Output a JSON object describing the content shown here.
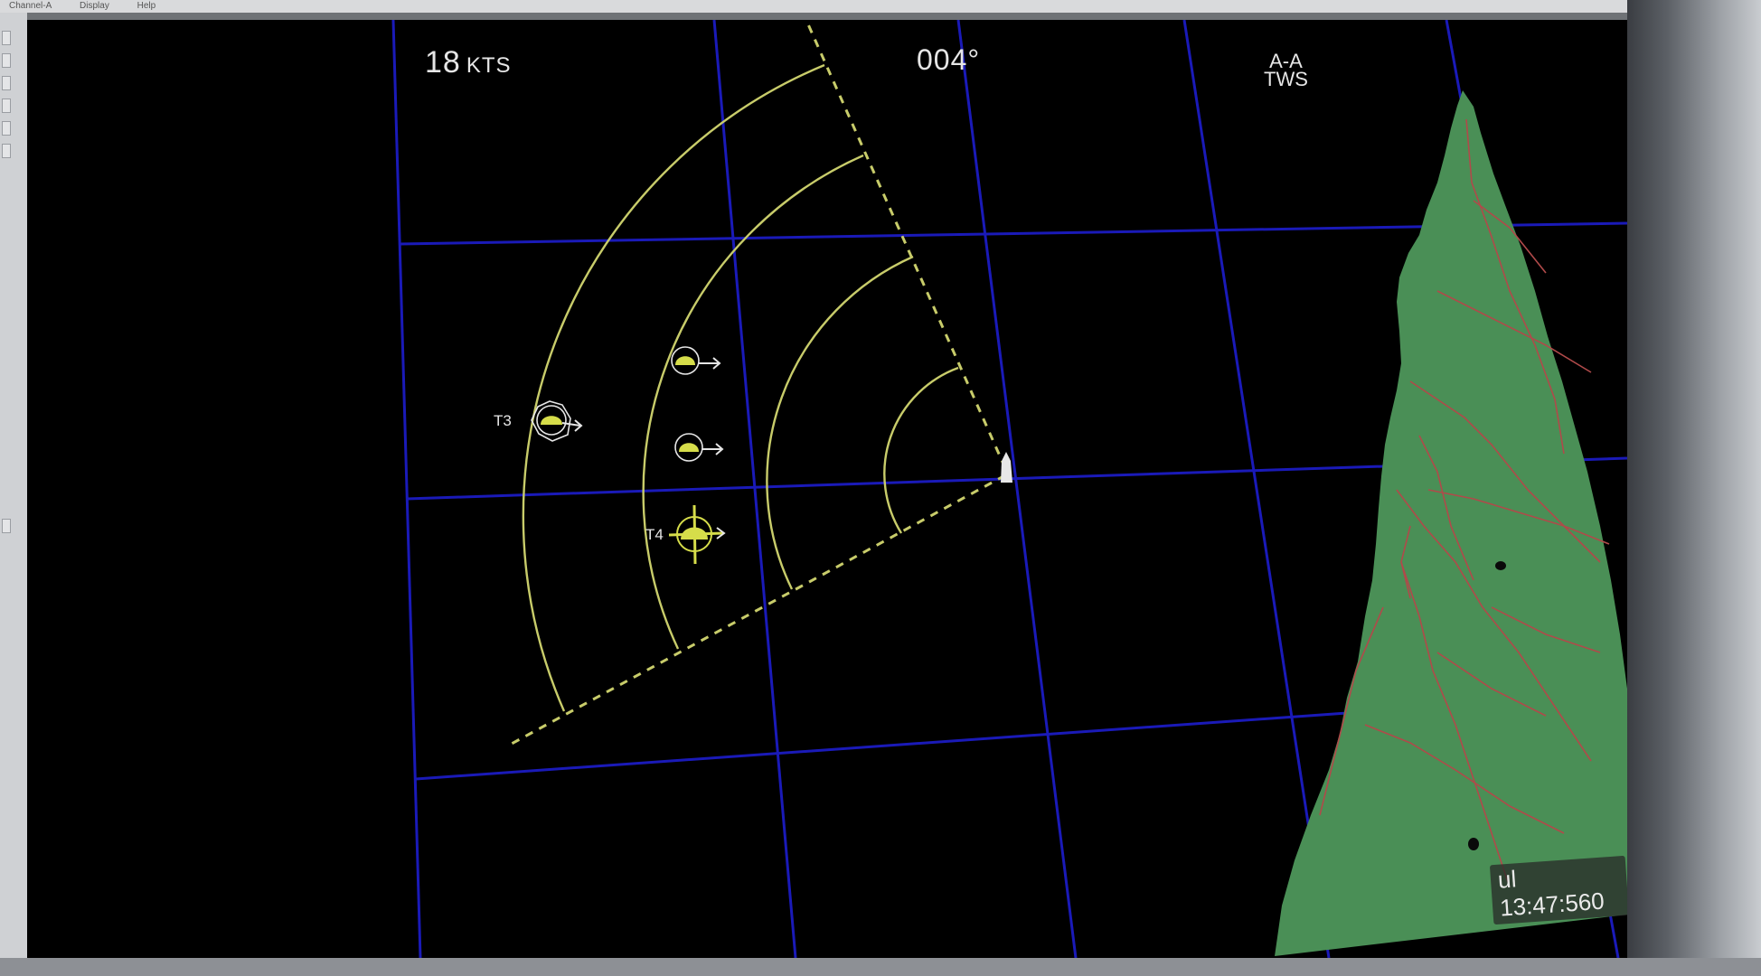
{
  "menu": {
    "items": [
      "Channel-A",
      "Display",
      "Help"
    ]
  },
  "hud": {
    "speed_value": "18",
    "speed_unit": "KTS",
    "heading": "004°",
    "mode_line1": "A-A",
    "mode_line2": "TWS"
  },
  "targets": [
    {
      "id": "T3",
      "label": "T3",
      "type": "hexagon-locked"
    },
    {
      "id": "t-unlabeled-1",
      "label": "",
      "type": "contact"
    },
    {
      "id": "t-unlabeled-2",
      "label": "",
      "type": "contact"
    },
    {
      "id": "T4",
      "label": "T4",
      "type": "crosshair-selected"
    }
  ],
  "clock": "ul 13:47:560",
  "colors": {
    "background": "#000000",
    "grid": "#1a1ab8",
    "radar": "#c8cc6a",
    "target_fill": "#d6dd4a",
    "land": "#4a8f56",
    "roads": "#b04a4a",
    "text": "#e6e6e6"
  },
  "icons": {
    "ownship": "ownship-icon",
    "contact": "contact-icon",
    "hexagon": "hexagon-lock-icon",
    "crosshair": "crosshair-icon"
  }
}
